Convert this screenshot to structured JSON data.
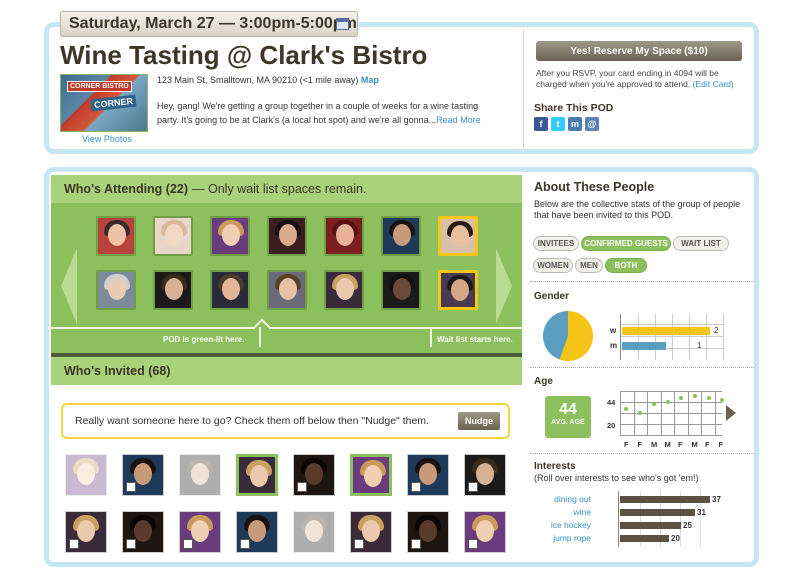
{
  "event": {
    "date_time": "Saturday, March 27 — 3:00pm-5:00pm",
    "title": "Wine Tasting @ Clark's Bistro",
    "photo_sign_top": "CORNER BISTRO",
    "photo_sign": "CORNER",
    "view_photos": "View Photos",
    "address": "123 Main St, Smalltown, MA 90210 (<1 mile away)",
    "map_link": "Map",
    "description": "Hey, gang! We're getting a group together in a couple of weeks for a wine tasting party. It's going to be at Clark's (a local hot spot) and we're all gonna...",
    "read_more": "Read More"
  },
  "rsvp": {
    "button": "Yes! Reserve My Space ($10)",
    "note": "After you RSVP, your card ending in 4094 will be charged when you're approved to attend.",
    "edit_card": "(Edit Card)"
  },
  "share": {
    "title": "Share This POD",
    "icons": [
      "facebook-icon",
      "twitter-icon",
      "myspace-icon",
      "email-icon"
    ]
  },
  "attending": {
    "title": "Who's Attending (22)",
    "note": "— Only wait list spaces remain.",
    "green_lit": "POD is green-lit here.",
    "wait_list": "Wait list starts here."
  },
  "invited": {
    "title": "Who's Invited (68)",
    "prompt": "Really want someone here to go? Check them off below then \"Nudge\" them.",
    "nudge": "Nudge"
  },
  "about": {
    "title": "About These People",
    "desc": "Below are the collective stats of the group of people that have been invited to this POD.",
    "filters_row1": [
      "INVITEES",
      "CONFIRMED GUESTS",
      "WAIT LIST"
    ],
    "filters_row2": [
      "WOMEN",
      "MEN",
      "BOTH"
    ],
    "active": [
      "CONFIRMED GUESTS",
      "BOTH"
    ]
  },
  "gender": {
    "title": "Gender",
    "labels": [
      "w",
      "m"
    ],
    "values": [
      2,
      1
    ],
    "colors": [
      "#f5c518",
      "#5b9ec2"
    ]
  },
  "age": {
    "title": "Age",
    "avg": "44",
    "avg_label": "AVG. AGE",
    "y_ticks": [
      "44",
      "20"
    ],
    "x_labels": [
      "F",
      "F",
      "M",
      "M",
      "F",
      "M",
      "F",
      "F"
    ]
  },
  "interests": {
    "title": "Interests",
    "subtitle": "(Roll over interests to see who's got 'em!)",
    "items": [
      {
        "label": "dining out",
        "value": "37"
      },
      {
        "label": "wine",
        "value": "31"
      },
      {
        "label": "ice hockey",
        "value": "25"
      },
      {
        "label": "jump rope",
        "value": "20"
      }
    ]
  }
}
